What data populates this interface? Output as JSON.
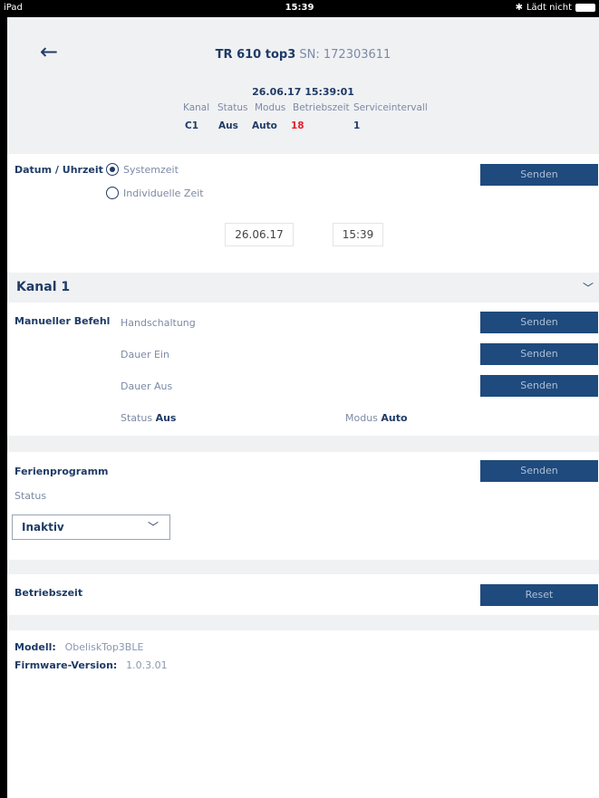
{
  "statusbar": {
    "device": "iPad",
    "time": "15:39",
    "battery_text": "Lädt nicht"
  },
  "header": {
    "model": "TR 610 top3",
    "sn_label": "SN:",
    "sn_value": "172303611",
    "datetime": "26.06.17 15:39:01",
    "columns": [
      "Kanal",
      "Status",
      "Modus",
      "Betriebszeit",
      "Serviceintervall"
    ],
    "values": [
      "C1",
      "Aus",
      "Auto",
      "18",
      "1"
    ]
  },
  "datum": {
    "label": "Datum / Uhrzeit",
    "option_system": "Systemzeit",
    "option_individual": "Individuelle Zeit",
    "date": "26.06.17",
    "time": "15:39",
    "send": "Senden"
  },
  "kanal": {
    "title": "Kanal 1",
    "manual_label": "Manueller Befehl",
    "rows": [
      {
        "label": "Handschaltung",
        "button": "Senden"
      },
      {
        "label": "Dauer Ein",
        "button": "Senden"
      },
      {
        "label": "Dauer Aus",
        "button": "Senden"
      }
    ],
    "status_label": "Status",
    "status_value": "Aus",
    "mode_label": "Modus",
    "mode_value": "Auto"
  },
  "ferien": {
    "label": "Ferienprogramm",
    "status_label": "Status",
    "select_value": "Inaktiv",
    "send": "Senden"
  },
  "betrieb": {
    "label": "Betriebszeit",
    "reset": "Reset"
  },
  "info": {
    "model_label": "Modell:",
    "model_value": "ObeliskTop3BLE",
    "fw_label": "Firmware-Version:",
    "fw_value": "1.0.3.01"
  }
}
